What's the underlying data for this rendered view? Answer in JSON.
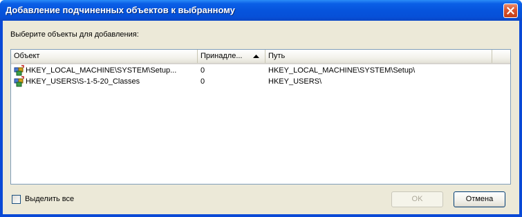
{
  "window": {
    "title": "Добавление подчиненных объектов к выбранному"
  },
  "prompt": "Выберите объекты для добавления:",
  "columns": [
    {
      "label": "Объект"
    },
    {
      "label": "Принадле...",
      "sorted": "ascending"
    },
    {
      "label": "Путь"
    }
  ],
  "rows": [
    {
      "object": "HKEY_LOCAL_MACHINE\\SYSTEM\\Setup...",
      "owner": "0",
      "path": "HKEY_LOCAL_MACHINE\\SYSTEM\\Setup\\",
      "icon": "registry-key-icon"
    },
    {
      "object": "HKEY_USERS\\S-1-5-20_Classes",
      "owner": "0",
      "path": "HKEY_USERS\\",
      "icon": "registry-key-icon"
    }
  ],
  "select_all": {
    "label": "Выделить все",
    "checked": false
  },
  "buttons": {
    "ok": "OK",
    "ok_enabled": false,
    "cancel": "Отмена"
  },
  "colors": {
    "title_bar": "#0654dd",
    "close_button": "#d9532c",
    "dialog_bg": "#ece9d8",
    "list_border": "#7f9db9"
  }
}
